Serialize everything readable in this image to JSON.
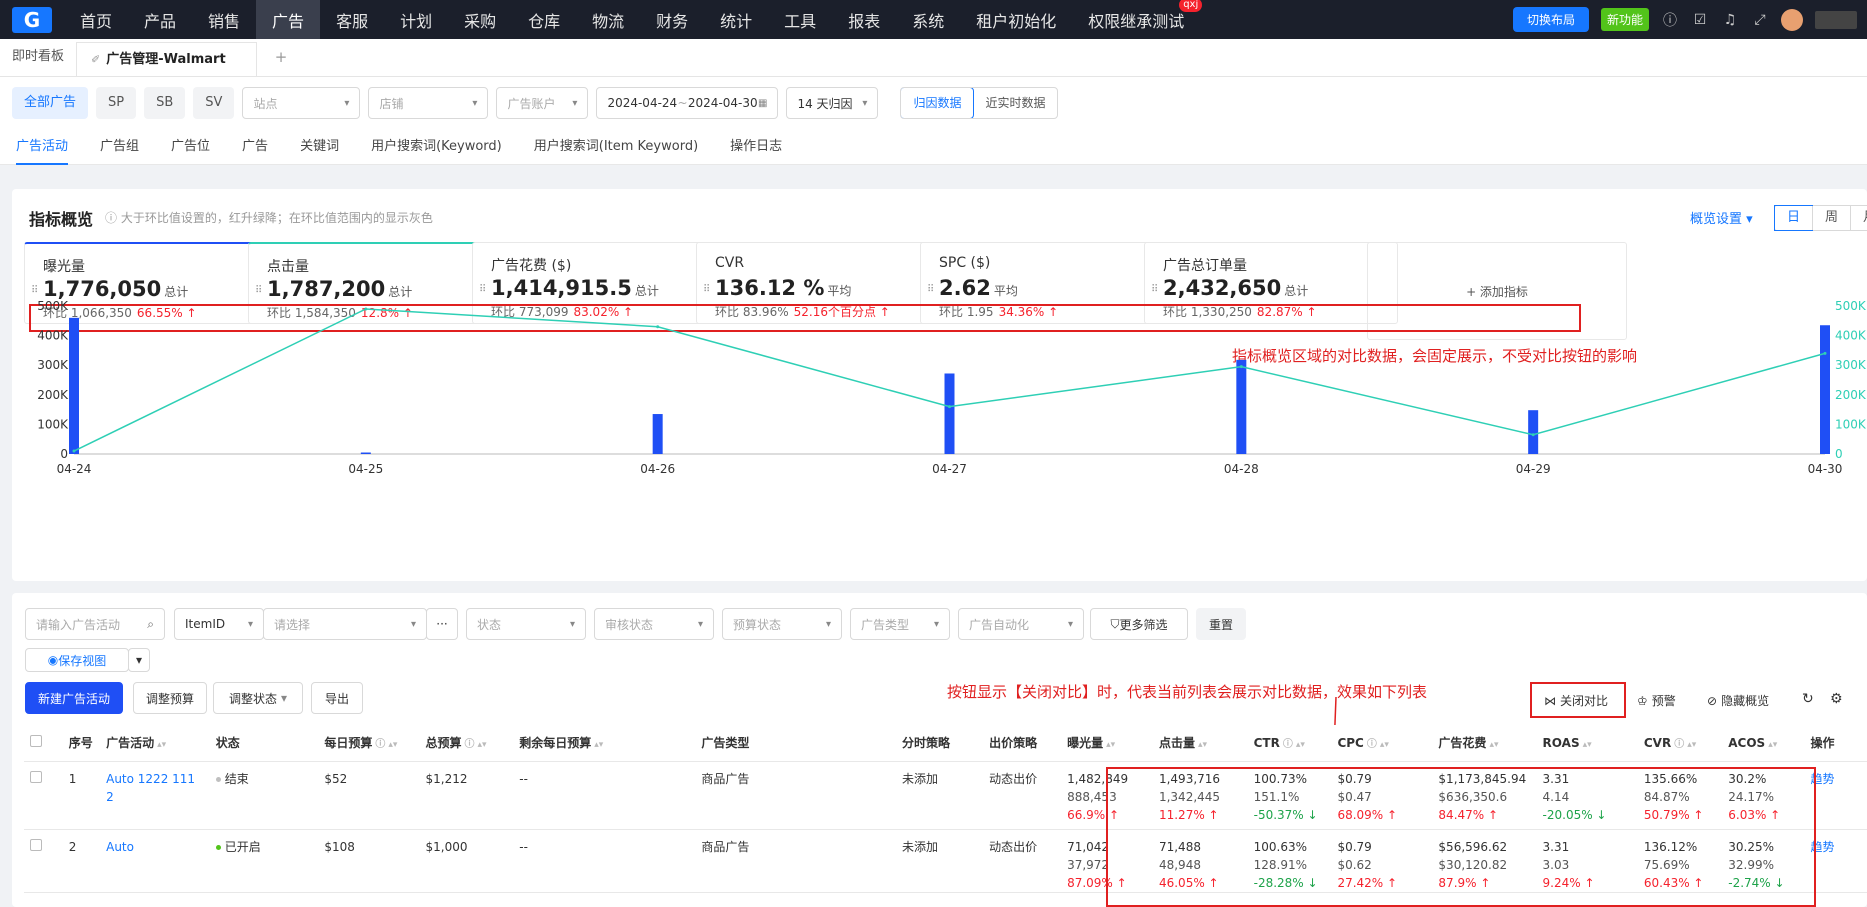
{
  "nav": {
    "logo": "G",
    "items": [
      "首页",
      "产品",
      "销售",
      "广告",
      "客服",
      "计划",
      "采购",
      "仓库",
      "物流",
      "财务",
      "统计",
      "工具",
      "报表",
      "系统",
      "租户初始化",
      "权限继承测试"
    ],
    "active_index": 3,
    "badge": "qxj",
    "switch_layout": "切换布局",
    "new_feature": "新功能"
  },
  "tabs": {
    "home": "即时看板",
    "current": "广告管理-Walmart",
    "add": "+"
  },
  "filters": {
    "pills": [
      "全部广告",
      "SP",
      "SB",
      "SV"
    ],
    "site": "站点",
    "store": "店铺",
    "account": "广告账户",
    "date_start": "2024-04-24",
    "date_sep": "~",
    "date_end": "2024-04-30",
    "attribution": "14 天归因",
    "data_modes": [
      "归因数据",
      "近实时数据"
    ]
  },
  "subtabs": [
    "广告活动",
    "广告组",
    "广告位",
    "广告",
    "关键词",
    "用户搜索词(Keyword)",
    "用户搜索词(Item Keyword)",
    "操作日志"
  ],
  "overview": {
    "title": "指标概览",
    "hint": "大于环比值设置的，红升绿降；在环比值范围内的显示灰色",
    "settings": "概览设置",
    "periods": [
      "日",
      "周",
      "月"
    ],
    "add_metric": "+ 添加指标",
    "cards": [
      {
        "name": "曝光量",
        "value": "1,776,050",
        "unit": "总计",
        "cmp_label": "环比",
        "cmp_value": "1,066,350",
        "change": "66.55% ↑"
      },
      {
        "name": "点击量",
        "value": "1,787,200",
        "unit": "总计",
        "cmp_label": "环比",
        "cmp_value": "1,584,350",
        "change": "12.8% ↑"
      },
      {
        "name": "广告花费 ($)",
        "value": "1,414,915.5",
        "unit": "总计",
        "cmp_label": "环比",
        "cmp_value": "773,099",
        "change": "83.02% ↑"
      },
      {
        "name": "CVR",
        "value": "136.12 %",
        "unit": "平均",
        "cmp_label": "环比",
        "cmp_value": "83.96%",
        "change": "52.16个百分点 ↑"
      },
      {
        "name": "SPC ($)",
        "value": "2.62",
        "unit": "平均",
        "cmp_label": "环比",
        "cmp_value": "1.95",
        "change": "34.36% ↑"
      },
      {
        "name": "广告总订单量",
        "value": "2,432,650",
        "unit": "总计",
        "cmp_label": "环比",
        "cmp_value": "1,330,250",
        "change": "82.87% ↑"
      }
    ],
    "annotation": "指标概览区域的对比数据，会固定展示，不受对比按钮的影响"
  },
  "chart_data": {
    "type": "bar",
    "categories": [
      "04-24",
      "04-25",
      "04-26",
      "04-27",
      "04-28",
      "04-29",
      "04-30"
    ],
    "series": [
      {
        "values": [
          460000,
          5000,
          135000,
          272000,
          318000,
          148000,
          435000
        ]
      },
      {
        "values": [
          10000,
          490000,
          430000,
          160000,
          295000,
          65000,
          340000
        ]
      }
    ],
    "ylim": [
      0,
      500000
    ],
    "yticks": [
      "0",
      "100K",
      "200K",
      "300K",
      "400K",
      "500K"
    ],
    "colors": {
      "bar": "#1f4ff5",
      "line": "#2ecfb5"
    },
    "grid": false
  },
  "list": {
    "search_placeholder": "请输入广告活动",
    "itemid": "ItemID",
    "choose": "请选择",
    "more_dots": "···",
    "status": "状态",
    "review": "审核状态",
    "budget_status": "预算状态",
    "ad_type": "广告类型",
    "automation": "广告自动化",
    "more_filters": "更多筛选",
    "reset": "重置",
    "save_view": "保存视图",
    "new_campaign": "新建广告活动",
    "adjust_budget": "调整预算",
    "adjust_status": "调整状态",
    "export": "导出",
    "annotation": "按钮显示【关闭对比】时，代表当前列表会展示对比数据，效果如下列表",
    "close_compare": "关闭对比",
    "alert": "预警",
    "hide_overview": "隐藏概览",
    "headers": [
      "序号",
      "广告活动",
      "状态",
      "每日预算",
      "总预算",
      "剩余每日预算",
      "广告类型",
      "分时策略",
      "出价策略",
      "曝光量",
      "点击量",
      "CTR",
      "CPC",
      "广告花费",
      "ROAS",
      "CVR",
      "ACOS",
      "操作"
    ],
    "rows": [
      {
        "index": "1",
        "name": "Auto  1222 111 2",
        "status": "结束",
        "status_color": "#bfbfbf",
        "daily": "$52",
        "total": "$1,212",
        "remain": "--",
        "type": "商品广告",
        "time": "未添加",
        "bid": "动态出价",
        "metrics": [
          [
            "1,482,849",
            "888,453",
            "66.9% ↑",
            "up"
          ],
          [
            "1,493,716",
            "1,342,445",
            "11.27% ↑",
            "up"
          ],
          [
            "100.73%",
            "151.1%",
            "-50.37% ↓",
            "down"
          ],
          [
            "$0.79",
            "$0.47",
            "68.09% ↑",
            "up"
          ],
          [
            "$1,173,845.94",
            "$636,350.6",
            "84.47% ↑",
            "up"
          ],
          [
            "3.31",
            "4.14",
            "-20.05% ↓",
            "down"
          ],
          [
            "135.66%",
            "84.87%",
            "50.79% ↑",
            "up"
          ],
          [
            "30.2%",
            "24.17%",
            "6.03% ↑",
            "up"
          ]
        ],
        "action": "趋势"
      },
      {
        "index": "2",
        "name": "Auto",
        "status": "已开启",
        "status_color": "#52c41a",
        "daily": "$108",
        "total": "$1,000",
        "remain": "--",
        "type": "商品广告",
        "time": "未添加",
        "bid": "动态出价",
        "metrics": [
          [
            "71,042",
            "37,972",
            "87.09% ↑",
            "up"
          ],
          [
            "71,488",
            "48,948",
            "46.05% ↑",
            "up"
          ],
          [
            "100.63%",
            "128.91%",
            "-28.28% ↓",
            "down"
          ],
          [
            "$0.79",
            "$0.62",
            "27.42% ↑",
            "up"
          ],
          [
            "$56,596.62",
            "$30,120.82",
            "87.9% ↑",
            "up"
          ],
          [
            "3.31",
            "3.03",
            "9.24% ↑",
            "up"
          ],
          [
            "136.12%",
            "75.69%",
            "60.43% ↑",
            "up"
          ],
          [
            "30.25%",
            "32.99%",
            "-2.74% ↓",
            "down"
          ]
        ],
        "action": "趋势"
      }
    ]
  }
}
